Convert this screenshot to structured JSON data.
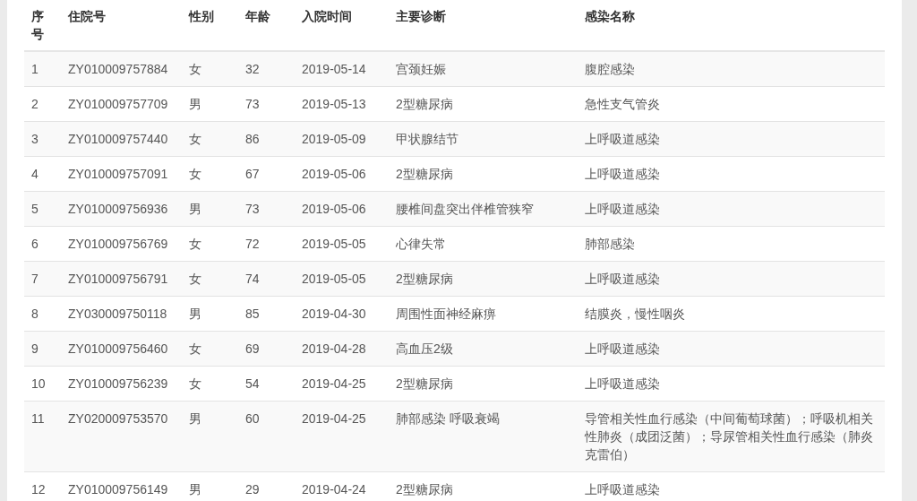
{
  "table": {
    "columns": [
      "序号",
      "住院号",
      "性别",
      "年龄",
      "入院时间",
      "主要诊断",
      "感染名称"
    ],
    "rows": [
      [
        "1",
        "ZY010009757884",
        "女",
        "32",
        "2019-05-14",
        "宫颈妊娠",
        "腹腔感染"
      ],
      [
        "2",
        "ZY010009757709",
        "男",
        "73",
        "2019-05-13",
        "2型糖尿病",
        "急性支气管炎"
      ],
      [
        "3",
        "ZY010009757440",
        "女",
        "86",
        "2019-05-09",
        "甲状腺结节",
        "上呼吸道感染"
      ],
      [
        "4",
        "ZY010009757091",
        "女",
        "67",
        "2019-05-06",
        "2型糖尿病",
        "上呼吸道感染"
      ],
      [
        "5",
        "ZY010009756936",
        "男",
        "73",
        "2019-05-06",
        "腰椎间盘突出伴椎管狭窄",
        "上呼吸道感染"
      ],
      [
        "6",
        "ZY010009756769",
        "女",
        "72",
        "2019-05-05",
        "心律失常",
        "肺部感染"
      ],
      [
        "7",
        "ZY010009756791",
        "女",
        "74",
        "2019-05-05",
        "2型糖尿病",
        "上呼吸道感染"
      ],
      [
        "8",
        "ZY030009750118",
        "男",
        "85",
        "2019-04-30",
        "周围性面神经麻痹",
        "结膜炎，慢性咽炎"
      ],
      [
        "9",
        "ZY010009756460",
        "女",
        "69",
        "2019-04-28",
        "高血压2级",
        "上呼吸道感染"
      ],
      [
        "10",
        "ZY010009756239",
        "女",
        "54",
        "2019-04-25",
        "2型糖尿病",
        "上呼吸道感染"
      ],
      [
        "11",
        "ZY020009753570",
        "男",
        "60",
        "2019-04-25",
        "肺部感染 呼吸衰竭",
        "导管相关性血行感染（中间葡萄球菌）；呼吸机相关性肺炎（成团泛菌）；导尿管相关性血行感染（肺炎克雷伯）"
      ],
      [
        "12",
        "ZY010009756149",
        "男",
        "29",
        "2019-04-24",
        "2型糖尿病",
        "上呼吸道感染"
      ]
    ]
  }
}
